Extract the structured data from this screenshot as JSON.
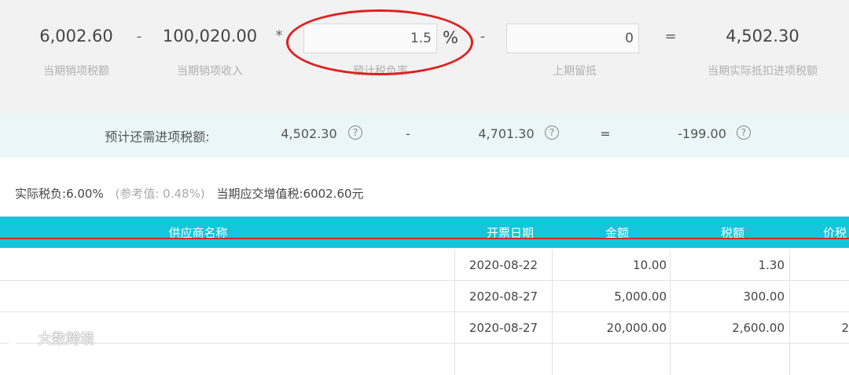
{
  "calc": {
    "sales_tax_value": "6,002.60",
    "sales_tax_label": "当期销项税额",
    "minus1": "-",
    "sales_income_value": "100,020.00",
    "sales_income_label": "当期销项收入",
    "multiply": "*",
    "rate_input": "1.5",
    "rate_unit": "%",
    "rate_label": "预计税负率",
    "minus2": "-",
    "carry_input": "0",
    "carry_label": "上期留抵",
    "equals": "=",
    "result_value": "4,502.30",
    "result_label": "当期实际抵扣进项税额"
  },
  "estimate": {
    "label": "预计还需进项税额:",
    "value1": "4,502.30",
    "minus": "-",
    "value2": "4,701.30",
    "equals": "=",
    "result": "-199.00",
    "help_glyph": "?"
  },
  "summary": {
    "actual_rate_label": "实际税负:",
    "actual_rate_value": "6.00%",
    "reference": "(参考值: 0.48%)",
    "vat_label": "当期应交增值税:",
    "vat_value": "6002.60元"
  },
  "table": {
    "columns": [
      "供应商名称",
      "开票日期",
      "金额",
      "税额",
      "价税"
    ],
    "rows": [
      {
        "supplier": "",
        "date": "2020-08-22",
        "amount": "10.00",
        "tax": "1.30",
        "total": ""
      },
      {
        "supplier": "",
        "date": "2020-08-27",
        "amount": "5,000.00",
        "tax": "300.00",
        "total": ""
      },
      {
        "supplier": "",
        "date": "2020-08-27",
        "amount": "20,000.00",
        "tax": "2,600.00",
        "total": "2"
      }
    ]
  },
  "watermark": {
    "text": "大数跨境",
    "icon": "logo-icon"
  },
  "colors": {
    "header_bg": "#13c6d9",
    "highlight": "#e02020",
    "panel_bg": "#f2f2f2",
    "estimate_bg": "#eaf6f8"
  }
}
